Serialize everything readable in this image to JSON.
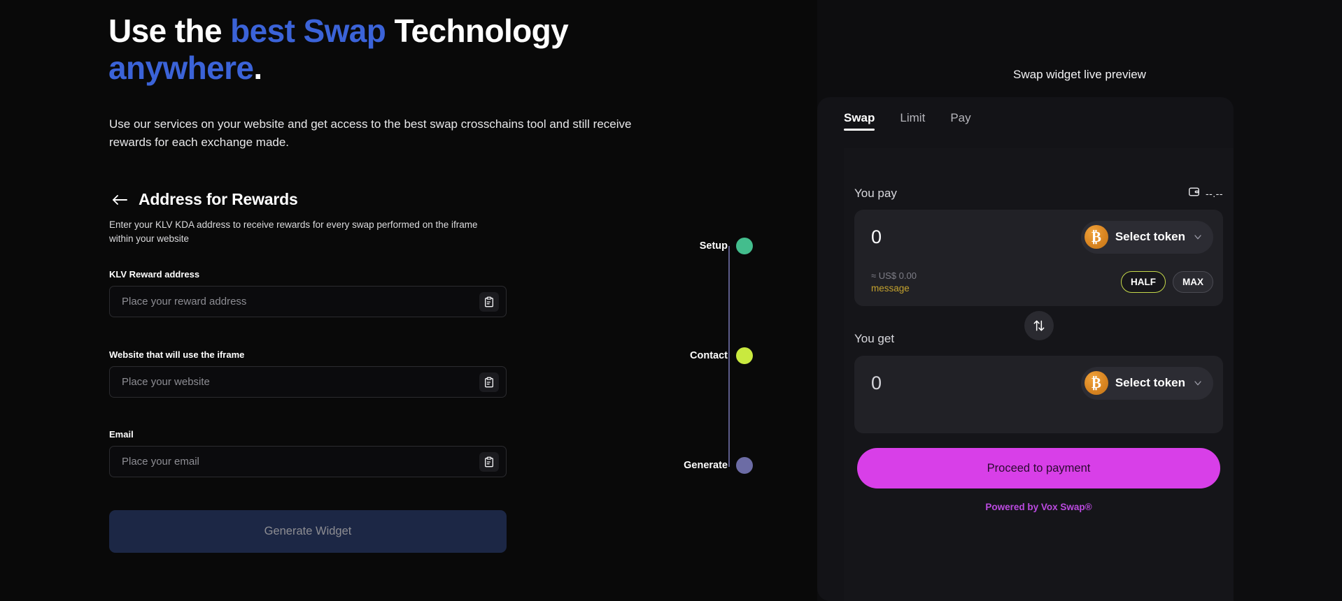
{
  "hero": {
    "headline_part1": "Use the ",
    "headline_accent1": "best Swap",
    "headline_part2": " Technology ",
    "headline_accent2": "anywhere",
    "headline_period": ".",
    "subcopy": "Use our services on your website and get access to the best swap crosschains tool and still receive rewards for each exchange made."
  },
  "form": {
    "back_icon": "arrow-left-icon",
    "title": "Address for Rewards",
    "description": "Enter your KLV KDA address to receive rewards for every swap performed on the iframe within your website",
    "fields": [
      {
        "label": "KLV Reward address",
        "placeholder": "Place your reward address",
        "value": "",
        "paste_icon": "clipboard-icon"
      },
      {
        "label": "Website that will use the iframe",
        "placeholder": "Place your website",
        "value": "",
        "paste_icon": "clipboard-icon"
      },
      {
        "label": "Email",
        "placeholder": "Place your email",
        "value": "",
        "paste_icon": "clipboard-icon"
      }
    ],
    "submit_label": "Generate Widget",
    "submit_enabled": false
  },
  "stepper": {
    "steps": [
      {
        "label": "Setup",
        "color": "#43bd8d"
      },
      {
        "label": "Contact",
        "color": "#c9e93f"
      },
      {
        "label": "Generate",
        "color": "#6c6ca5"
      }
    ],
    "line_color": "#5c5c8a"
  },
  "preview": {
    "title": "Swap widget live preview",
    "tabs": [
      {
        "label": "Swap",
        "active": true
      },
      {
        "label": "Limit",
        "active": false
      },
      {
        "label": "Pay",
        "active": false
      }
    ],
    "pay": {
      "label": "You pay",
      "balance_icon": "wallet-icon",
      "balance": "--.--",
      "amount": "0",
      "token_label": "Select token",
      "token_icon": "bitcoin-icon",
      "token_symbol": "₿",
      "chevron_icon": "chevron-down-icon",
      "usd_approx": "≈ US$ 0.00",
      "message": "message",
      "half_label": "HALF",
      "max_label": "MAX"
    },
    "swap_toggle_icon": "arrows-up-down-icon",
    "get": {
      "label": "You get",
      "amount": "0",
      "token_label": "Select token",
      "token_icon": "bitcoin-icon",
      "token_symbol": "₿",
      "chevron_icon": "chevron-down-icon"
    },
    "cta_label": "Proceed to payment",
    "footer": "Powered by Vox Swap®"
  },
  "colors": {
    "accent_blue": "#3b63d8",
    "magenta": "#d83fe8",
    "purple_text": "#bb4ae0",
    "gold": "#c4a22e",
    "lime": "#c5d94a"
  }
}
